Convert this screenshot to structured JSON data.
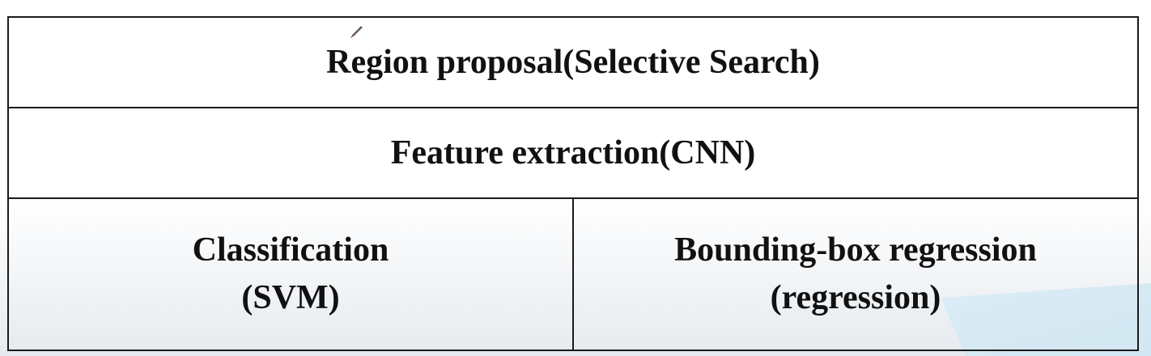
{
  "diagram": {
    "row1": {
      "label": "Region proposal(Selective Search)"
    },
    "row2": {
      "label": "Feature extraction(CNN)"
    },
    "row3": {
      "left": {
        "line1": "Classification",
        "line2": "(SVM)"
      },
      "right": {
        "line1": "Bounding-box regression",
        "line2": "(regression)"
      }
    }
  },
  "colors": {
    "border": "#1a1a1a",
    "text": "#111111",
    "accent": "#d9ecf6",
    "cursor": "#c0392b"
  },
  "icons": {
    "cursor": "pencil-cursor-icon"
  }
}
